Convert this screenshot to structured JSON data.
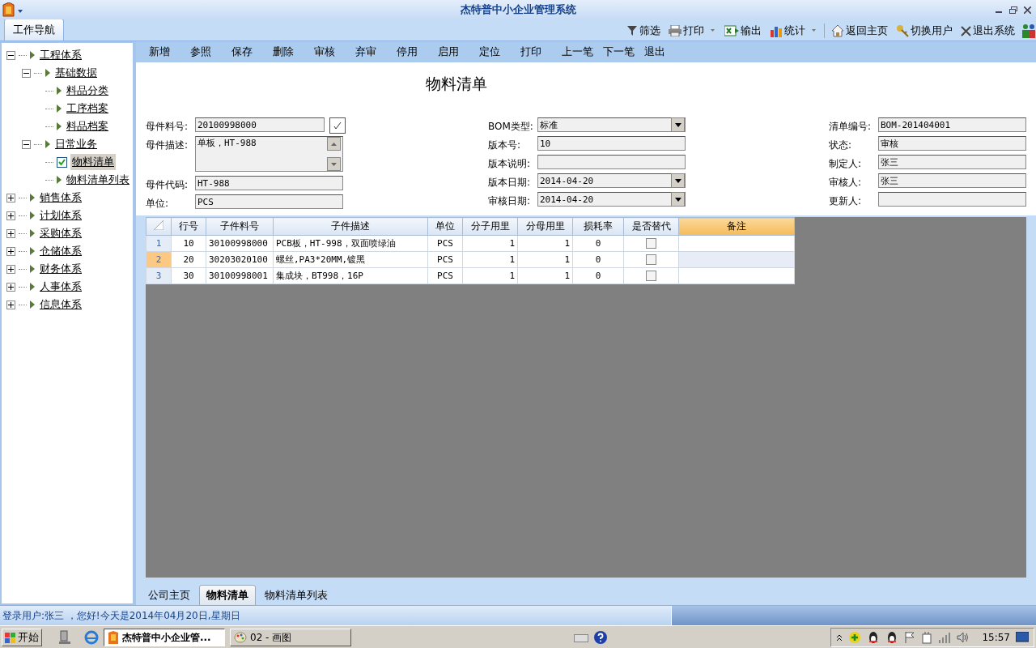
{
  "window": {
    "title": "杰特普中小企业管理系统"
  },
  "nav_tab": {
    "label": "工作导航"
  },
  "top_toolbar": [
    {
      "kind": "filter",
      "label": "筛选",
      "dropdown": false
    },
    {
      "kind": "print",
      "label": "打印",
      "dropdown": true
    },
    {
      "kind": "export",
      "label": "输出",
      "dropdown": false
    },
    {
      "kind": "stats",
      "label": "统计",
      "dropdown": true
    },
    {
      "kind": "home",
      "label": "返回主页",
      "dropdown": false
    },
    {
      "kind": "switch",
      "label": "切换用户",
      "dropdown": false
    },
    {
      "kind": "exit",
      "label": "退出系统",
      "dropdown": false
    }
  ],
  "tree": [
    {
      "label": "工程体系",
      "expanded": true,
      "children": [
        {
          "label": "基础数据",
          "expanded": true,
          "children": [
            {
              "label": "料品分类",
              "selected": false
            },
            {
              "label": "工序档案",
              "selected": false
            },
            {
              "label": "料品档案",
              "selected": false
            }
          ]
        },
        {
          "label": "日常业务",
          "expanded": true,
          "children": [
            {
              "label": "物料清单",
              "selected": true
            },
            {
              "label": "物料清单列表",
              "selected": false
            }
          ]
        }
      ]
    },
    {
      "label": "销售体系",
      "expanded": false
    },
    {
      "label": "计划体系",
      "expanded": false
    },
    {
      "label": "采购体系",
      "expanded": false
    },
    {
      "label": "仓储体系",
      "expanded": false
    },
    {
      "label": "财务体系",
      "expanded": false
    },
    {
      "label": "人事体系",
      "expanded": false
    },
    {
      "label": "信息体系",
      "expanded": false
    }
  ],
  "action_bar": [
    "新增",
    "参照",
    "保存",
    "删除",
    "审核",
    "弃审",
    "停用",
    "启用",
    "定位",
    "打印",
    "上一笔",
    "下一笔",
    "退出"
  ],
  "form": {
    "title": "物料清单",
    "columns": [
      [
        {
          "label": "母件料号:",
          "kind": "lookup",
          "value": "20100998000"
        },
        {
          "label": "母件描述:",
          "kind": "memo",
          "value": "单板，HT-988"
        },
        {
          "label": "母件代码:",
          "kind": "text",
          "value": "HT-988"
        },
        {
          "label": "单位:",
          "kind": "text",
          "value": "PCS"
        }
      ],
      [
        {
          "label": "BOM类型:",
          "kind": "combo",
          "value": "标准"
        },
        {
          "label": "版本号:",
          "kind": "text",
          "value": "10"
        },
        {
          "label": "版本说明:",
          "kind": "text"
        },
        {
          "label": "版本日期:",
          "kind": "combo",
          "value": "2014-04-20"
        },
        {
          "label": "审核日期:",
          "kind": "combo",
          "value": "2014-04-20"
        }
      ],
      [
        {
          "label": "清单编号:",
          "kind": "text",
          "value": "BOM-201404001"
        },
        {
          "label": "状态:",
          "kind": "text",
          "value": "审核"
        },
        {
          "label": "制定人:",
          "kind": "text",
          "value": "张三"
        },
        {
          "label": "审核人:",
          "kind": "text",
          "value": "张三"
        },
        {
          "label": "更新人:",
          "kind": "text"
        }
      ]
    ]
  },
  "grid": {
    "columns": [
      {
        "label": "行号",
        "selected": false
      },
      {
        "label": "子件料号",
        "selected": false
      },
      {
        "label": "子件描述",
        "selected": false
      },
      {
        "label": "单位",
        "selected": false
      },
      {
        "label": "分子用里",
        "selected": false
      },
      {
        "label": "分母用里",
        "selected": false
      },
      {
        "label": "损耗率",
        "selected": false
      },
      {
        "label": "是否替代",
        "selected": false
      },
      {
        "label": "备注",
        "selected": true
      }
    ],
    "rows": [
      {
        "number": "1",
        "selected": false,
        "line": "10",
        "item_no": "30100998000",
        "description": "PCB板，HT-998，双面喷绿油",
        "unit": "PCS",
        "numerator": "1",
        "denominator": "1",
        "loss_rate": "0",
        "substitute": false,
        "remark": ""
      },
      {
        "number": "2",
        "selected": true,
        "line": "20",
        "item_no": "30203020100",
        "description": "螺丝,PA3*20MM,镀黑",
        "unit": "PCS",
        "numerator": "1",
        "denominator": "1",
        "loss_rate": "0",
        "substitute": false,
        "remark": ""
      },
      {
        "number": "3",
        "selected": false,
        "line": "30",
        "item_no": "30100998001",
        "description": "集成块，BT998，16P",
        "unit": "PCS",
        "numerator": "1",
        "denominator": "1",
        "loss_rate": "0",
        "substitute": false,
        "remark": ""
      }
    ]
  },
  "bottom_tabs": [
    {
      "label": "公司主页",
      "selected": false
    },
    {
      "label": "物料清单",
      "selected": true
    },
    {
      "label": "物料清单列表",
      "selected": false
    }
  ],
  "status_bar": "登录用户:张三 ，您好!今天是2014年04月20日,星期日",
  "taskbar": {
    "start": "开始",
    "windows": [
      {
        "label": "杰特普中小企业管...",
        "selected": true
      },
      {
        "label": "02 - 画图",
        "selected": false
      }
    ],
    "clock": "15:57"
  }
}
